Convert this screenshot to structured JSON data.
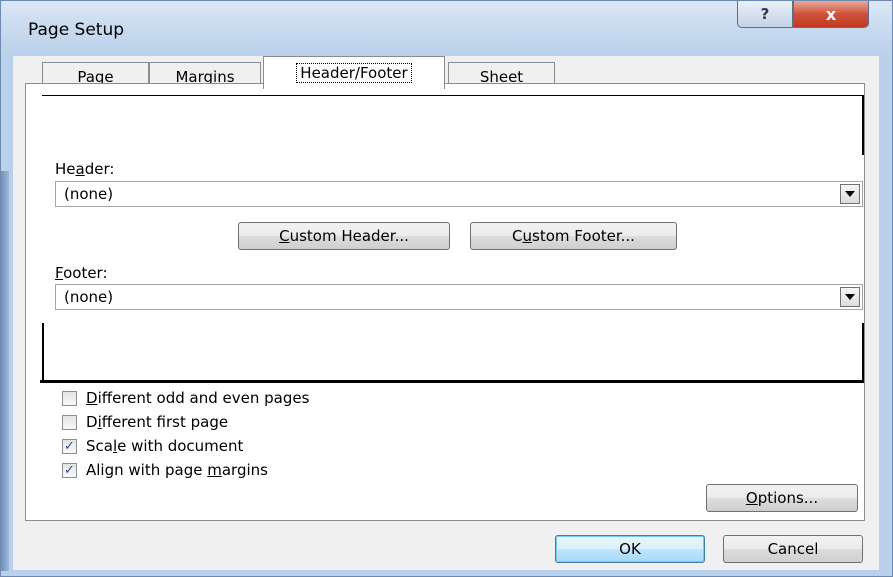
{
  "window": {
    "title": "Page Setup",
    "help_glyph": "?",
    "close_glyph": "x"
  },
  "tabs": [
    {
      "label": "Page"
    },
    {
      "label": "Margins"
    },
    {
      "label": "Header/Footer",
      "active": true
    },
    {
      "label": "Sheet"
    }
  ],
  "header": {
    "label_pre": "He",
    "label_accel": "a",
    "label_post": "der:",
    "value": "(none)"
  },
  "footer": {
    "label_pre": "",
    "label_accel": "F",
    "label_post": "ooter:",
    "value": "(none)"
  },
  "buttons": {
    "custom_header": {
      "pre": "",
      "accel": "C",
      "post": "ustom Header..."
    },
    "custom_footer": {
      "pre": "C",
      "accel": "u",
      "post": "stom Footer..."
    },
    "options": {
      "pre": "",
      "accel": "O",
      "post": "ptions..."
    },
    "ok": "OK",
    "cancel": "Cancel"
  },
  "checkboxes": [
    {
      "pre": "",
      "accel": "D",
      "post": "ifferent odd and even pages",
      "checked": false
    },
    {
      "pre": "D",
      "accel": "i",
      "post": "fferent first page",
      "checked": false
    },
    {
      "pre": "Sca",
      "accel": "l",
      "post": "e with document",
      "checked": true
    },
    {
      "pre": "Align with page ",
      "accel": "m",
      "post": "argins",
      "checked": true
    }
  ],
  "colors": {
    "window_frame": "#b9d1ea",
    "dialog_bg": "#f0f0f0",
    "ok_accent": "#3c7fb1",
    "close_red": "#c23a22"
  }
}
